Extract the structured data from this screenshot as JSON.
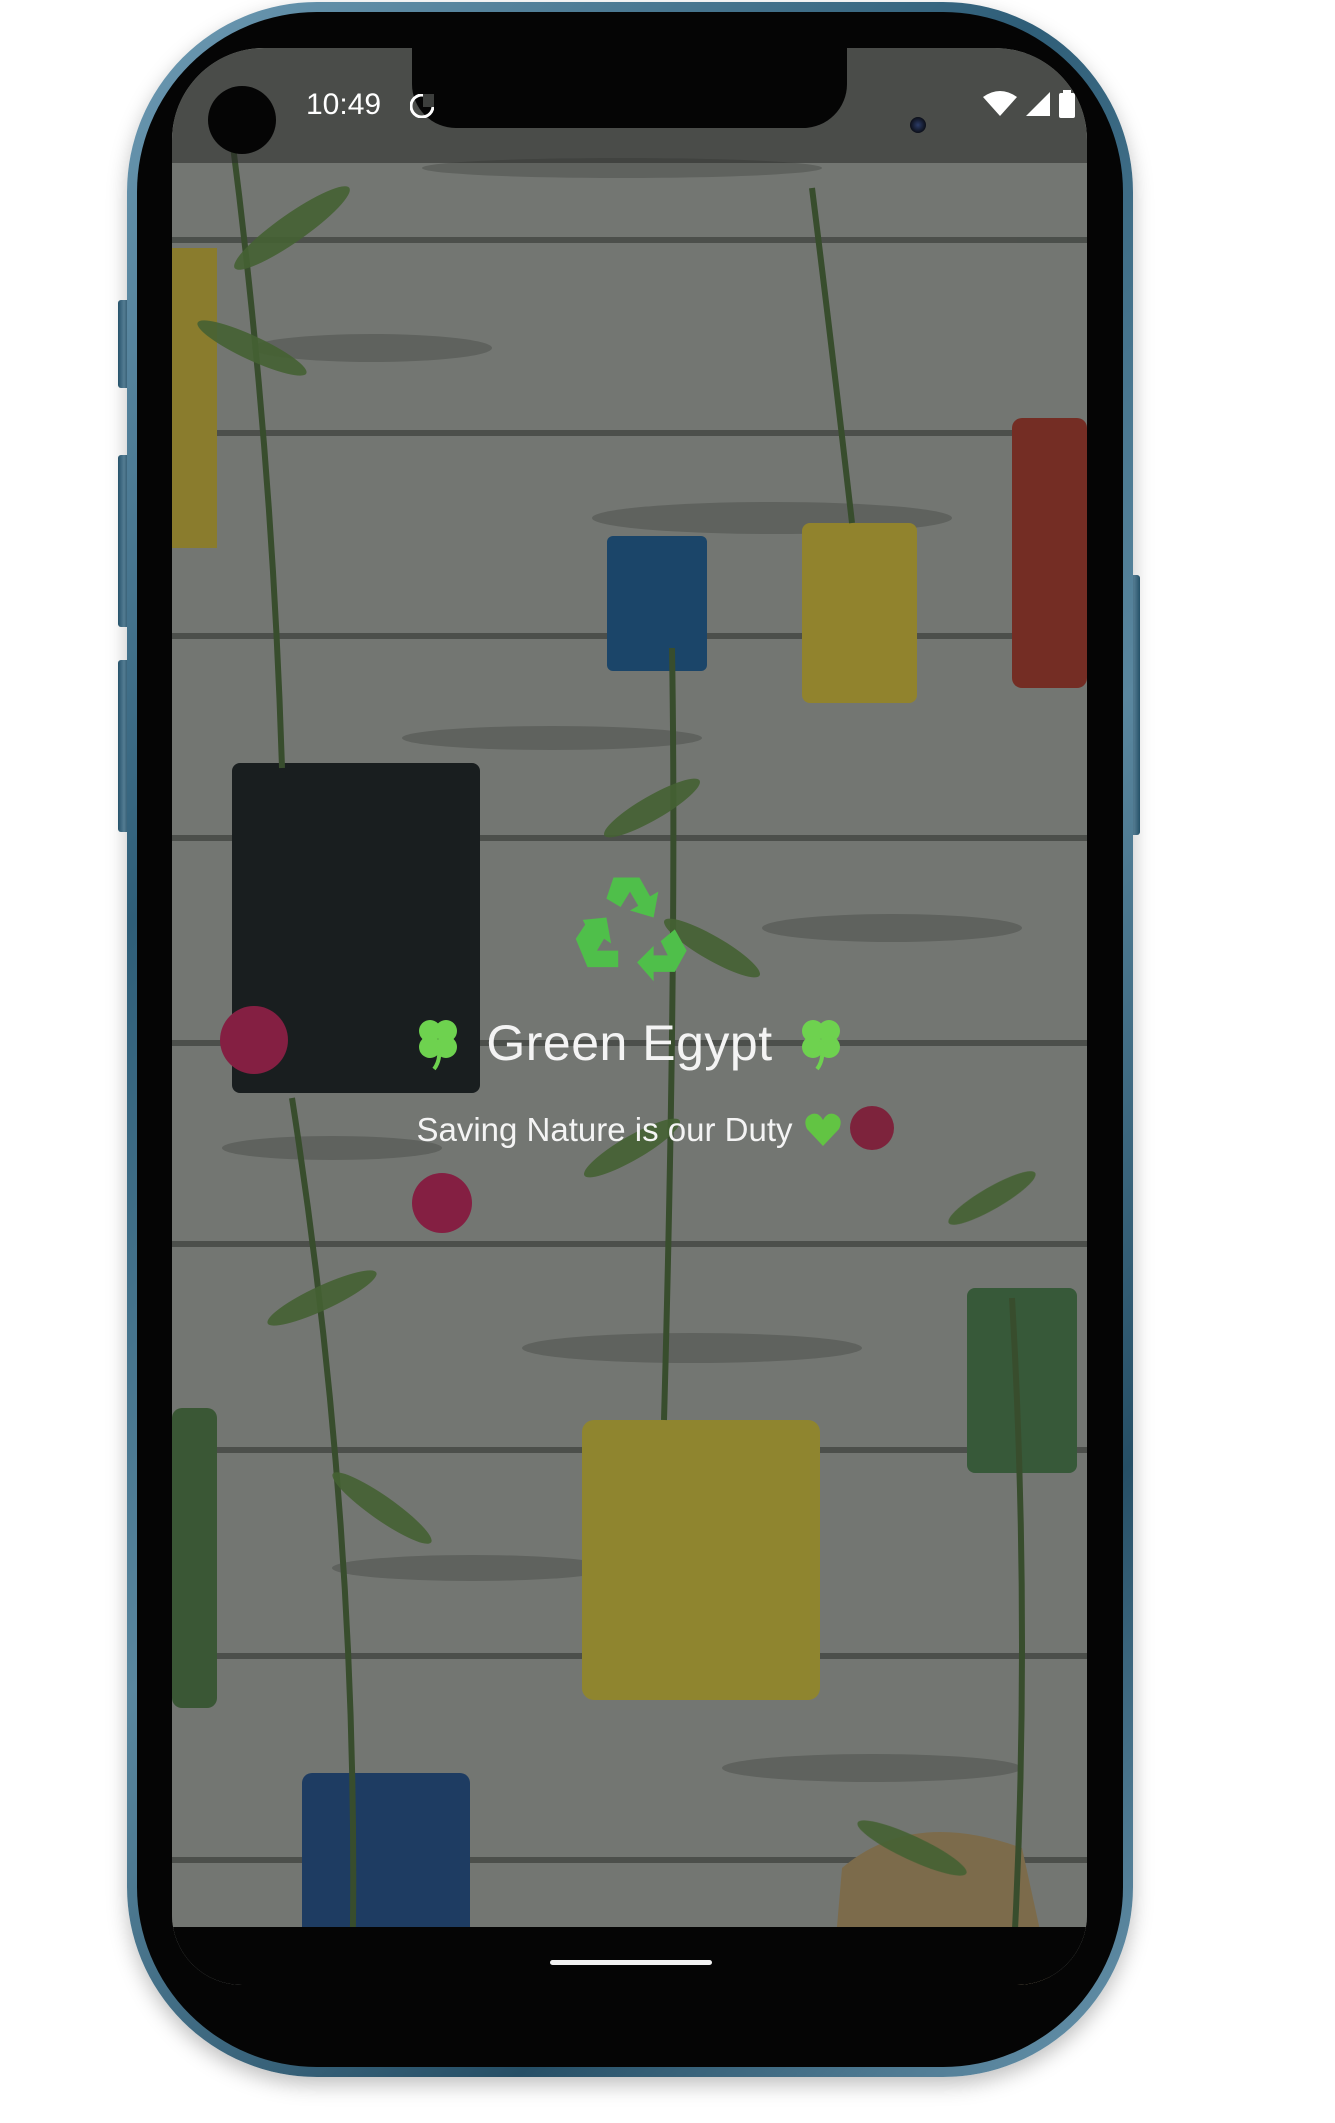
{
  "status_bar": {
    "time": "10:49",
    "icons": [
      "do-not-disturb-icon",
      "wifi-icon",
      "cellular-signal-icon",
      "battery-icon"
    ]
  },
  "splash": {
    "logo_icon": "recycle-icon",
    "title": "Green Egypt",
    "title_left_icon": "four-leaf-clover-icon",
    "title_right_icon": "four-leaf-clover-icon",
    "subtitle": "Saving Nature is our Duty",
    "subtitle_icon": "green-heart-icon",
    "background": "wall-of-hanging-can-planters-photo"
  },
  "colors": {
    "recycle_green": "#4fbf4a",
    "clover_green": "#6ed24f",
    "heart_green": "#62c443",
    "text": "#f4f4f4",
    "frame_blue": "#3f6e88"
  },
  "navigation": {
    "home_indicator": "home-indicator"
  }
}
